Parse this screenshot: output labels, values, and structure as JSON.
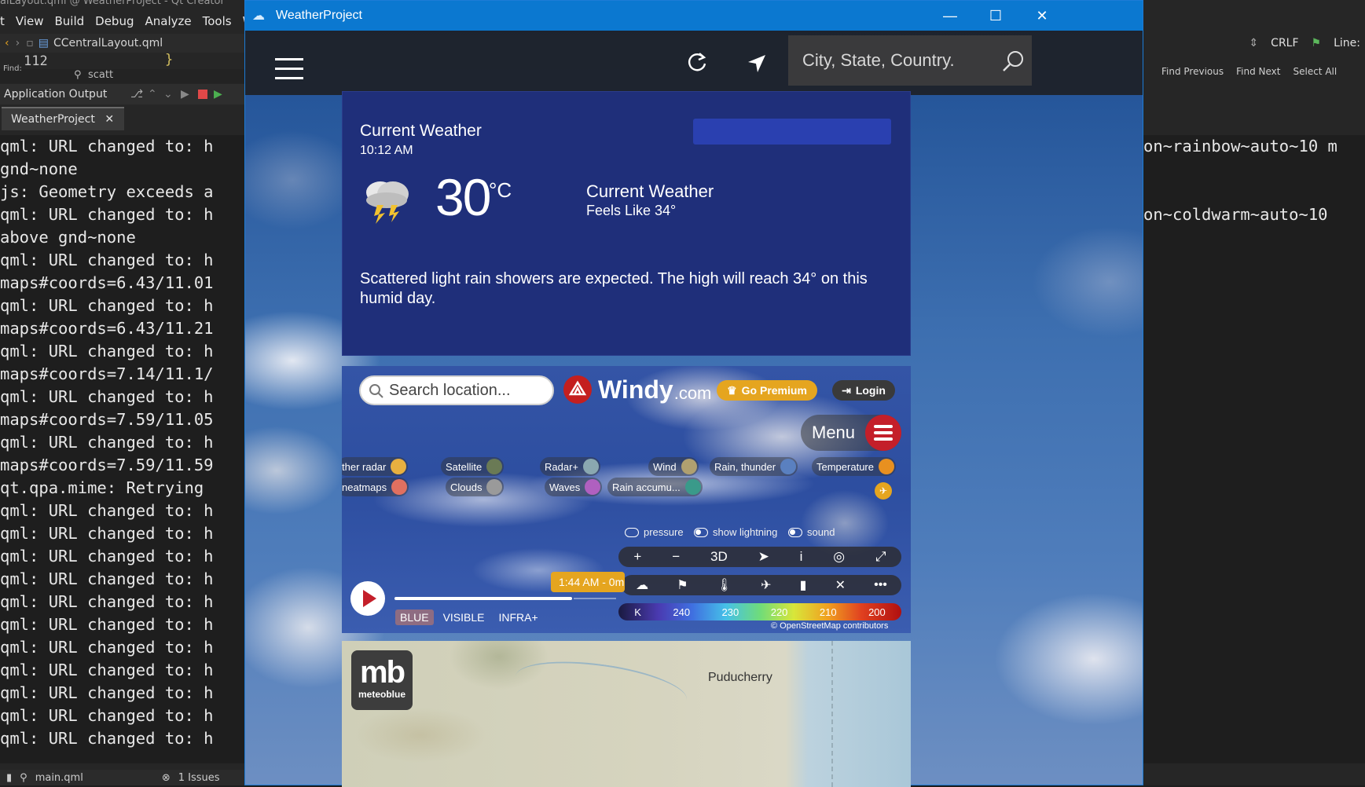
{
  "qt": {
    "title": "alLayout.qml @ WeatherProject - Qt Creator",
    "menu": [
      "t",
      "View",
      "Build",
      "Debug",
      "Analyze",
      "Tools",
      "Wi"
    ],
    "file_name": "CCentralLayout.qml",
    "line_number": "112",
    "brace": "}",
    "find_label": "Find:",
    "find_value": "scatt",
    "pane_title": "Application Output",
    "tab_label": "WeatherProject",
    "output_lines": [
      "qml: URL changed to: h",
      "gnd~none",
      "js: Geometry exceeds a",
      "qml: URL changed to: h",
      "above gnd~none",
      "qml: URL changed to: h",
      "maps#coords=6.43/11.01",
      "qml: URL changed to: h",
      "maps#coords=6.43/11.21",
      "qml: URL changed to: h",
      "maps#coords=7.14/11.1/",
      "qml: URL changed to: h",
      "maps#coords=7.59/11.05",
      "qml: URL changed to: h",
      "maps#coords=7.59/11.59",
      "qt.qpa.mime: Retrying",
      "qml: URL changed to: h",
      "qml: URL changed to: h",
      "qml: URL changed to: h",
      "qml: URL changed to: h",
      "qml: URL changed to: h",
      "qml: URL changed to: h",
      "qml: URL changed to: h",
      "qml: URL changed to: h",
      "qml: URL changed to: h",
      "qml: URL changed to: h",
      "qml: URL changed to: h"
    ],
    "right_toolbar": {
      "eol": "CRLF",
      "line": "Line:"
    },
    "right_find": [
      "Find Previous",
      "Find Next",
      "Select All"
    ],
    "right_output": [
      "on~rainbow~auto~10 m",
      "",
      "",
      "on~coldwarm~auto~10"
    ],
    "status": {
      "file": "main.qml",
      "issues": "1 Issues"
    }
  },
  "window": {
    "title": "WeatherProject",
    "controls": {
      "minimize": "—",
      "maximize": "☐",
      "close": "✕"
    }
  },
  "appbar": {
    "search_placeholder": "City, State, Country."
  },
  "weather": {
    "title": "Current Weather",
    "time": "10:12 AM",
    "temperature": "30",
    "unit": "°C",
    "condition": "Current Weather",
    "feels_like": "Feels Like 34°",
    "description": "Scattered light rain showers are expected. The high will reach 34° on this humid day.",
    "icon": "thunderstorm-icon"
  },
  "windy": {
    "search_placeholder": "Search location...",
    "brand": "Windy",
    "brand_suffix": ".com",
    "premium": "Go Premium",
    "login": "Login",
    "menu": "Menu",
    "layers": [
      {
        "label": "ther radar",
        "color": "#e8b040"
      },
      {
        "label": "Satellite",
        "color": "#6a7a55"
      },
      {
        "label": "Radar+",
        "color": "#8aa8b0"
      },
      {
        "label": "Wind",
        "color": "#b0a070"
      },
      {
        "label": "Rain, thunder",
        "color": "#5a80c0"
      },
      {
        "label": "Temperature",
        "color": "#e89020"
      },
      {
        "label": "neatmaps",
        "color": "#e07060"
      },
      {
        "label": "Clouds",
        "color": "#9a9a9a"
      },
      {
        "label": "Waves",
        "color": "#b060c0"
      },
      {
        "label": "Rain accumu...",
        "color": "#3a9a8a"
      }
    ],
    "toggles": {
      "pressure": "pressure",
      "lightning": "show lightning",
      "sound": "sound"
    },
    "controls": [
      "+",
      "−",
      "3D",
      "➤",
      "i",
      "◎",
      "⤢"
    ],
    "controls2": [
      "☁",
      "⚑",
      "🌡",
      "✈",
      "▮",
      "✕",
      "•••"
    ],
    "time_chip": "1:44 AM - 0m",
    "bands": [
      "BLUE",
      "VISIBLE",
      "INFRA+"
    ],
    "legend": [
      "K",
      "240",
      "230",
      "220",
      "210",
      "200"
    ],
    "attribution": "© OpenStreetMap contributors",
    "timeline_progress": 0.8
  },
  "meteoblue": {
    "logo_big": "mb",
    "logo_small": "meteoblue",
    "city": "Puducherry"
  }
}
